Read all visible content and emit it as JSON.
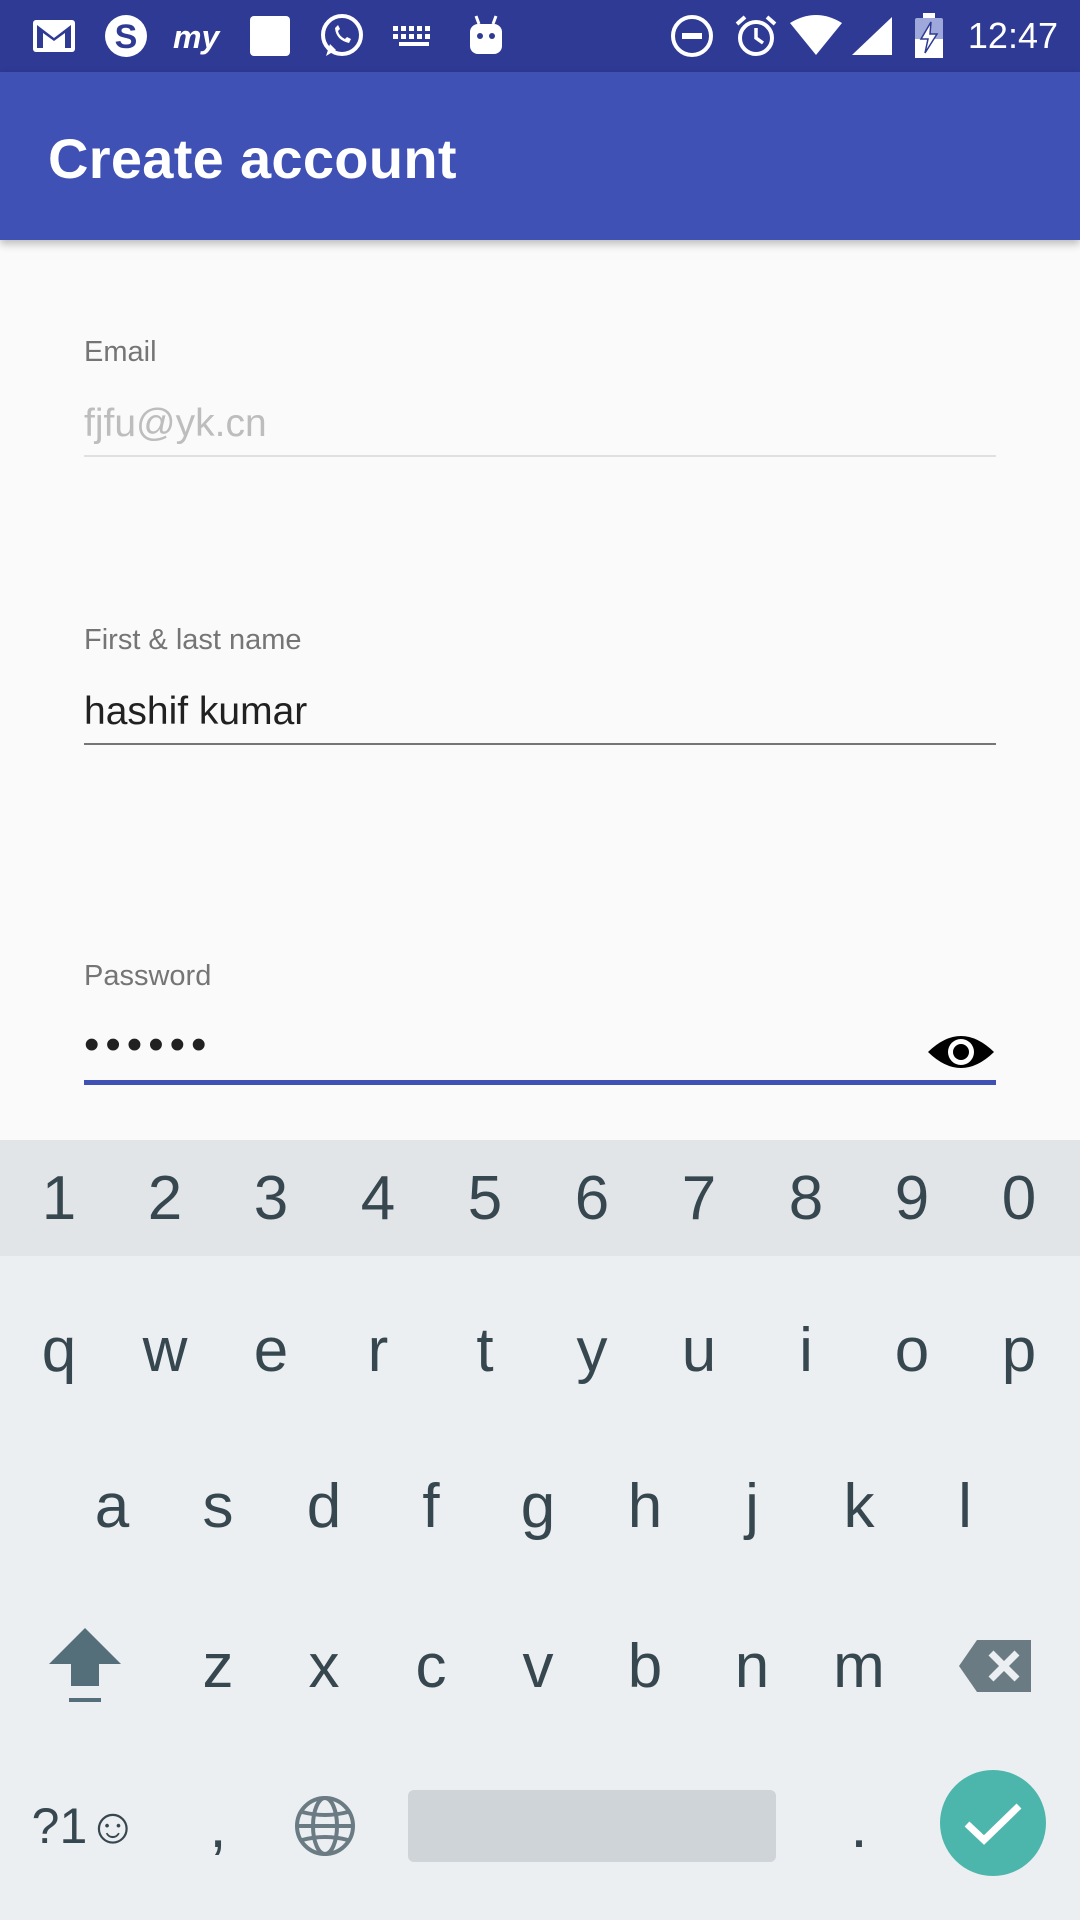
{
  "status_bar": {
    "time": "12:47",
    "left_icons": [
      "gmail-icon",
      "skype-icon",
      "myntra-icon",
      "square-app-icon",
      "whatsapp-icon",
      "keyboard-icon",
      "android-icon"
    ],
    "right_icons": [
      "do-not-disturb-icon",
      "alarm-icon",
      "wifi-icon",
      "signal-icon",
      "battery-icon"
    ]
  },
  "app_bar": {
    "title": "Create account"
  },
  "form": {
    "email": {
      "label": "Email",
      "value": "fjfu@yk.cn"
    },
    "name": {
      "label": "First & last name",
      "value": "hashif kumar"
    },
    "password": {
      "label": "Password",
      "value": "••••••"
    }
  },
  "keyboard": {
    "number_row": [
      "1",
      "2",
      "3",
      "4",
      "5",
      "6",
      "7",
      "8",
      "9",
      "0"
    ],
    "row1": [
      "q",
      "w",
      "e",
      "r",
      "t",
      "y",
      "u",
      "i",
      "o",
      "p"
    ],
    "row2": [
      "a",
      "s",
      "d",
      "f",
      "g",
      "h",
      "j",
      "k",
      "l"
    ],
    "row3": [
      "z",
      "x",
      "c",
      "v",
      "b",
      "n",
      "m"
    ],
    "symbols_label": "?1☺",
    "comma": ",",
    "period": ".",
    "accent_color": "#4db6ac"
  },
  "colors": {
    "status_bar": "#2e3a94",
    "app_bar": "#3f51b5",
    "focus_underline": "#3f51b5"
  }
}
